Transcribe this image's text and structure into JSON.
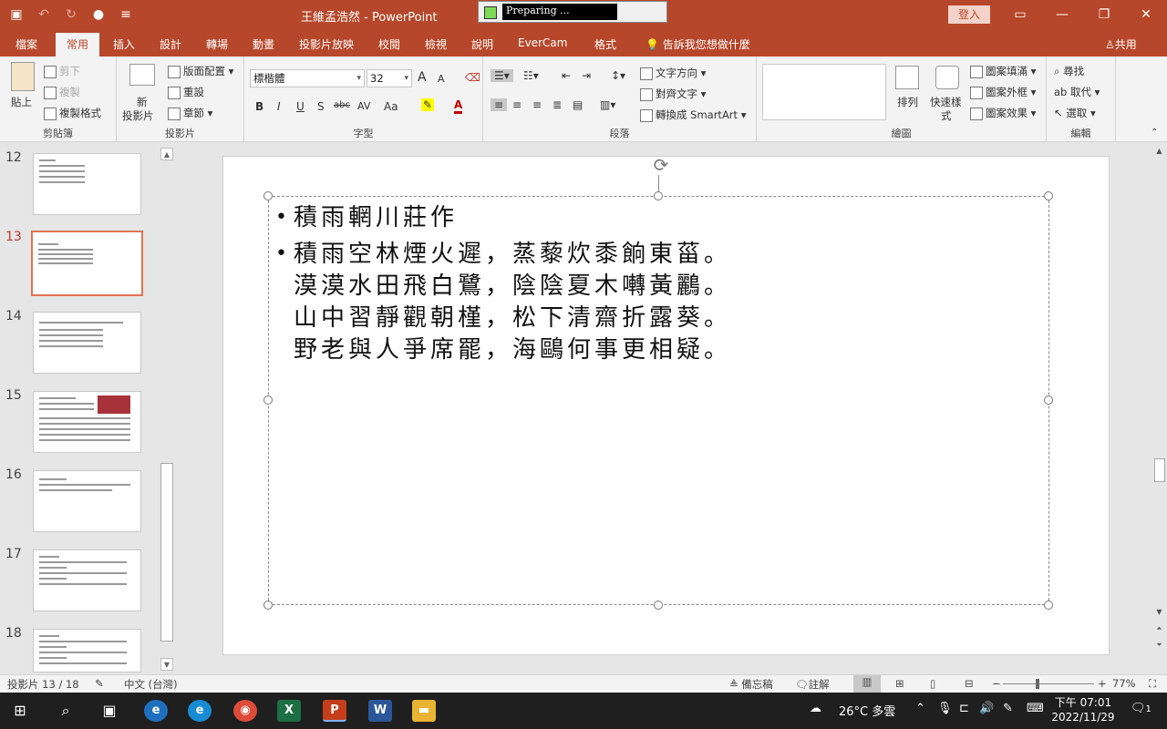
{
  "window": {
    "title": "王維孟浩然 - PowerPoint",
    "preparing": "Preparing ...",
    "login": "登入"
  },
  "tabs": [
    "檔案",
    "常用",
    "插入",
    "設計",
    "轉場",
    "動畫",
    "投影片放映",
    "校閱",
    "檢視",
    "說明",
    "EverCam",
    "格式"
  ],
  "active_tab": "常用",
  "tell_me": "告訴我您想做什麼",
  "share": "共用",
  "ribbon": {
    "clipboard": {
      "label": "剪貼簿",
      "paste": "貼上",
      "cut": "剪下",
      "copy": "複製",
      "format_painter": "複製格式"
    },
    "slides": {
      "label": "投影片",
      "new_slide": "新",
      "new_slide2": "投影片",
      "layout": "版面配置",
      "reset": "重設",
      "section": "章節"
    },
    "font": {
      "label": "字型",
      "font_name": "標楷體",
      "font_size": "32",
      "bold": "B",
      "italic": "I",
      "underline": "U",
      "shadow": "S",
      "strike": "abc",
      "spacing": "AV",
      "case": "Aa",
      "grow": "A",
      "shrink": "A",
      "font_color": "A"
    },
    "paragraph": {
      "label": "段落",
      "text_direction": "文字方向",
      "align_text": "對齊文字",
      "smartart": "轉換成 SmartArt"
    },
    "drawing": {
      "label": "繪圖",
      "arrange": "排列",
      "quick_styles": "快速樣",
      "quick_styles2": "式",
      "fill": "圖案填滿",
      "outline": "圖案外框",
      "effects": "圖案效果"
    },
    "editing": {
      "label": "編輯",
      "find": "尋找",
      "replace": "取代",
      "select": "選取"
    }
  },
  "slides": [
    {
      "num": "12"
    },
    {
      "num": "13",
      "active": true
    },
    {
      "num": "14"
    },
    {
      "num": "15"
    },
    {
      "num": "16"
    },
    {
      "num": "17"
    },
    {
      "num": "18"
    }
  ],
  "slide_content": {
    "title": "積雨輞川莊作",
    "lines": [
      "積雨空林煙火遲，蒸藜炊黍餉東菑。",
      "漠漠水田飛白鷺，陰陰夏木囀黃鸝。",
      "山中習靜觀朝槿，松下清齋折露葵。",
      "野老與人爭席罷，海鷗何事更相疑。"
    ]
  },
  "status": {
    "slide_info": "投影片 13 / 18",
    "language": "中文 (台灣)",
    "notes": "備忘稿",
    "comments": "註解",
    "zoom": "77%"
  },
  "taskbar": {
    "weather": "26°C 多雲",
    "time": "下午 07:01",
    "date": "2022/11/29",
    "notif": "1"
  },
  "colors": {
    "accent": "#b7472a",
    "selected_thumb": "#e0734f"
  }
}
